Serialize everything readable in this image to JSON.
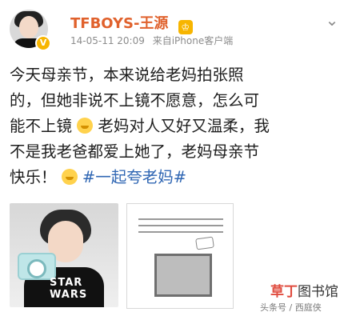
{
  "post": {
    "username": "TFBOYS-王源",
    "timestamp": "14-05-11 20:09",
    "source": "来自iPhone客户端",
    "content_parts": {
      "line1": "今天母亲节，本来说给老妈拍张照",
      "line2": "的，但她非说不上镜不愿意，怎么可",
      "line3a": "能不上镜",
      "line3b": "老妈对人又好又温柔，我",
      "line4": "不是我老爸都爱上她了，老妈母亲节",
      "line5": "快乐！",
      "hashtag": "#一起夸老妈#"
    }
  },
  "photo1": {
    "shirt_text": "STAR WARS"
  },
  "watermark": {
    "brand_accent": "草丁",
    "brand_rest": "图书馆",
    "credit": "头条号 / 西庭侠"
  },
  "colors": {
    "username": "#e0612c",
    "hashtag": "#2f66b3"
  }
}
